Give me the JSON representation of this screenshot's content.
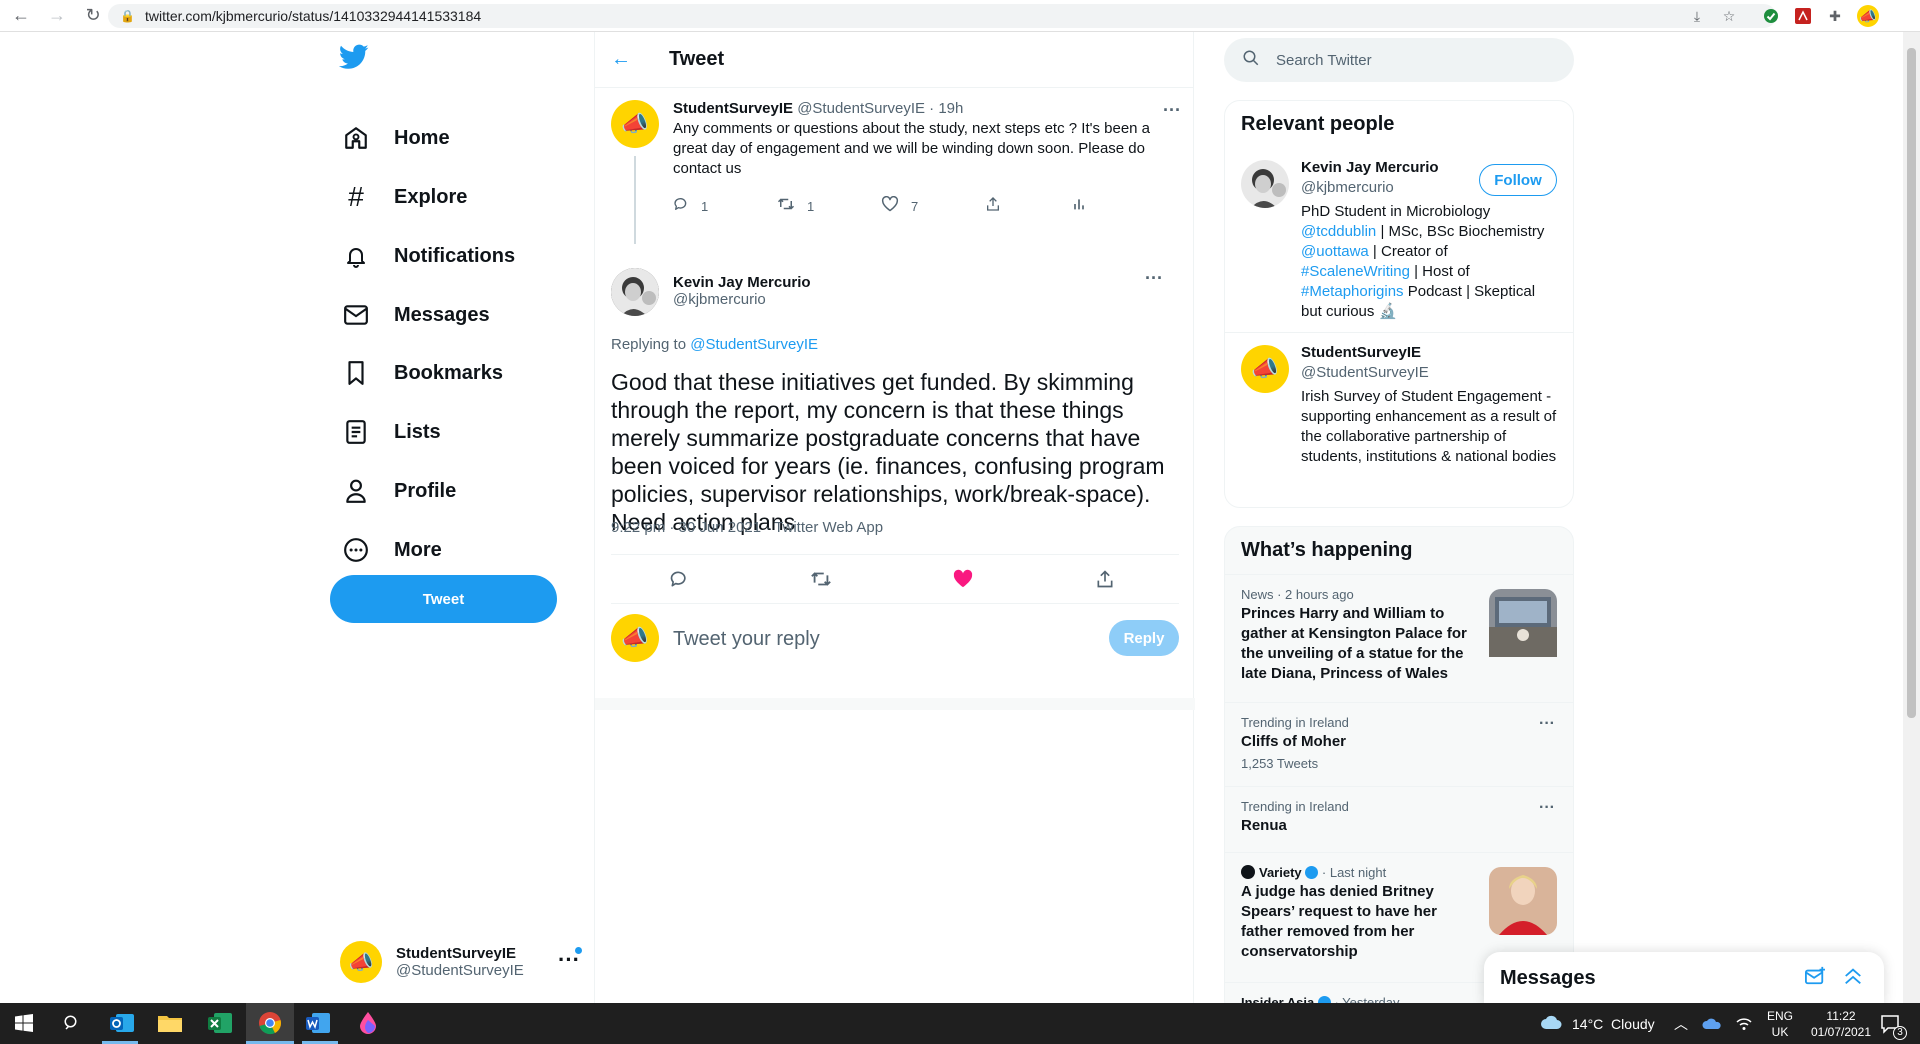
{
  "browser": {
    "url": "twitter.com/kjbmercurio/status/1410332944141533184"
  },
  "nav": {
    "items": [
      {
        "label": "Home",
        "icon": "home-icon"
      },
      {
        "label": "Explore",
        "icon": "hashtag-icon"
      },
      {
        "label": "Notifications",
        "icon": "bell-icon"
      },
      {
        "label": "Messages",
        "icon": "envelope-icon"
      },
      {
        "label": "Bookmarks",
        "icon": "bookmark-icon"
      },
      {
        "label": "Lists",
        "icon": "list-icon"
      },
      {
        "label": "Profile",
        "icon": "person-icon"
      },
      {
        "label": "More",
        "icon": "more-circle-icon"
      }
    ],
    "tweet_button": "Tweet",
    "account": {
      "name": "StudentSurveyIE",
      "handle": "@StudentSurveyIE"
    }
  },
  "main": {
    "title": "Tweet",
    "parent_tweet": {
      "name": "StudentSurveyIE",
      "handle": "@StudentSurveyIE",
      "time": "· 19h",
      "text": "Any comments or questions about the study, next steps etc ? It's been a great day of engagement and we will be winding down soon. Please do contact us",
      "replies": "1",
      "retweets": "1",
      "likes": "7"
    },
    "focal_tweet": {
      "name": "Kevin Jay Mercurio",
      "handle": "@kjbmercurio",
      "replying_prefix": "Replying to ",
      "replying_to": "@StudentSurveyIE",
      "text": "Good that these initiatives get funded. By skimming through the report, my concern is that these things merely summarize postgraduate concerns that have been voiced for years (ie. finances, confusing program policies, supervisor relationships, work/break-space). Need action plans",
      "meta": "9:22 pm · 30 Jun 2021 · Twitter Web App"
    },
    "reply_box": {
      "placeholder": "Tweet your reply",
      "button": "Reply"
    }
  },
  "right": {
    "search_placeholder": "Search Twitter",
    "relevant_title": "Relevant people",
    "people": [
      {
        "name": "Kevin Jay Mercurio",
        "handle": "@kjbmercurio",
        "follow": "Follow",
        "bio_1": "PhD Student in Microbiology ",
        "bio_link1": "@tcddublin",
        "bio_2": " | MSc, BSc Biochemistry ",
        "bio_link2": "@uottawa",
        "bio_3": " | Creator of ",
        "bio_link3": "#ScaleneWriting",
        "bio_4": " | Host of ",
        "bio_link4": "#Metaphorigins",
        "bio_5": " Podcast | Skeptical but curious 🔬"
      },
      {
        "name": "StudentSurveyIE",
        "handle": "@StudentSurveyIE",
        "bio": "Irish Survey of Student Engagement - supporting enhancement as a result of the collaborative partnership of students, institutions & national bodies"
      }
    ],
    "happening_title": "What’s happening",
    "trends": [
      {
        "meta": "News · 2 hours ago",
        "headline": "Princes Harry and William to gather at Kensington Palace for the unveiling of a statue for the late Diana, Princess of Wales"
      },
      {
        "meta": "Trending in Ireland",
        "headline": "Cliffs of Moher",
        "count": "1,253 Tweets"
      },
      {
        "meta": "Trending in Ireland",
        "headline": "Renua"
      },
      {
        "source": "Variety",
        "meta": "· Last night",
        "headline": "A judge has denied Britney Spears’ request to have her father removed from her conservatorship"
      },
      {
        "source": "Insider Asia",
        "meta": "· Yesterday"
      }
    ],
    "messages_dock": "Messages"
  },
  "taskbar": {
    "weather": "14°C  Cloudy",
    "lang_1": "ENG",
    "lang_2": "UK",
    "time": "11:22",
    "date": "01/07/2021",
    "notif_count": "3"
  },
  "colors": {
    "twitter_blue": "#1d9bf0",
    "like_red": "#f91880",
    "avatar_yellow": "#ffd400"
  }
}
